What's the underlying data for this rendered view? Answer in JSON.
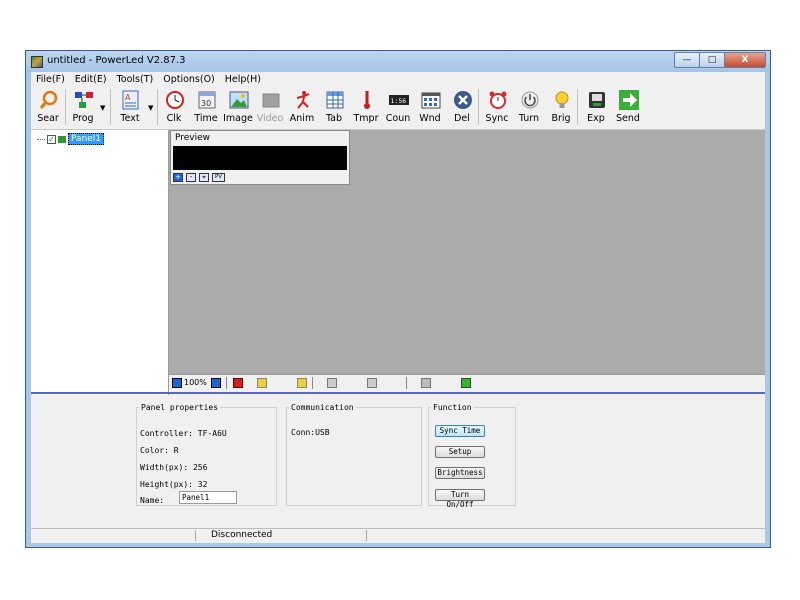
{
  "window": {
    "title": "untitled - PowerLed V2.87.3",
    "controls": {
      "minimize": "—",
      "maximize": "□",
      "close": "X"
    }
  },
  "menu": [
    "File(F)",
    "Edit(E)",
    "Tools(T)",
    "Options(O)",
    "Help(H)"
  ],
  "toolbar": [
    {
      "label": "Sear",
      "icon": "search-icon"
    },
    {
      "label": "Prog",
      "icon": "program-icon"
    },
    {
      "label": "Text",
      "icon": "text-icon"
    },
    {
      "label": "Clk",
      "icon": "clock-icon"
    },
    {
      "label": "Time",
      "icon": "calendar-icon"
    },
    {
      "label": "Image",
      "icon": "image-icon"
    },
    {
      "label": "Video",
      "icon": "video-icon",
      "disabled": true
    },
    {
      "label": "Anim",
      "icon": "animation-icon"
    },
    {
      "label": "Tab",
      "icon": "table-icon"
    },
    {
      "label": "Tmpr",
      "icon": "thermometer-icon"
    },
    {
      "label": "Coun",
      "icon": "counter-icon"
    },
    {
      "label": "Wnd",
      "icon": "window-icon"
    },
    {
      "label": "Del",
      "icon": "delete-icon"
    },
    {
      "label": "Sync",
      "icon": "alarm-clock-icon"
    },
    {
      "label": "Turn",
      "icon": "power-icon"
    },
    {
      "label": "Brig",
      "icon": "bulb-icon"
    },
    {
      "label": "Exp",
      "icon": "export-icon"
    },
    {
      "label": "Send",
      "icon": "send-arrow-icon"
    }
  ],
  "tree": {
    "panel_label": "Panel1"
  },
  "preview": {
    "title": "Preview",
    "buttons": [
      "+",
      "-",
      "⌖",
      "PV"
    ]
  },
  "status_strip": {
    "zoom": "100%"
  },
  "panel_properties": {
    "legend": "Panel properties",
    "controller": "Controller: TF-A6U",
    "color": "Color: R",
    "width": "Width(px): 256",
    "height": "Height(px): 32",
    "name_label": "Name:",
    "name_value": "Panel1"
  },
  "communication": {
    "legend": "Communication",
    "conn": "Conn:USB"
  },
  "function": {
    "legend": "Function",
    "sync_time": "Sync Time",
    "setup": "Setup",
    "brightness": "Brightness",
    "turn_onoff": "Turn On/Off"
  },
  "statusbar": {
    "text": "Disconnected"
  },
  "colors": {
    "workspace": "#ababab",
    "accent_bar": "#5566cc",
    "tree_selection": "#3399ff"
  }
}
